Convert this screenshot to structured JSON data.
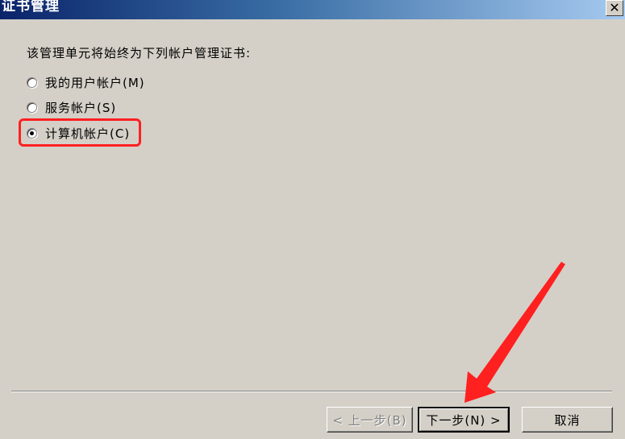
{
  "window": {
    "title": "证书管理",
    "close_glyph": "✕"
  },
  "prompt": "该管理单元将始终为下列帐户管理证书:",
  "options": [
    {
      "label": "我的用户帐户(M)",
      "checked": false
    },
    {
      "label": "服务帐户(S)",
      "checked": false
    },
    {
      "label": "计算机帐户(C)",
      "checked": true
    }
  ],
  "buttons": {
    "back": "< 上一步(B)",
    "next": "下一步(N) >",
    "cancel": "取消"
  },
  "colors": {
    "highlight": "#ff2020",
    "arrow": "#ff2020"
  }
}
